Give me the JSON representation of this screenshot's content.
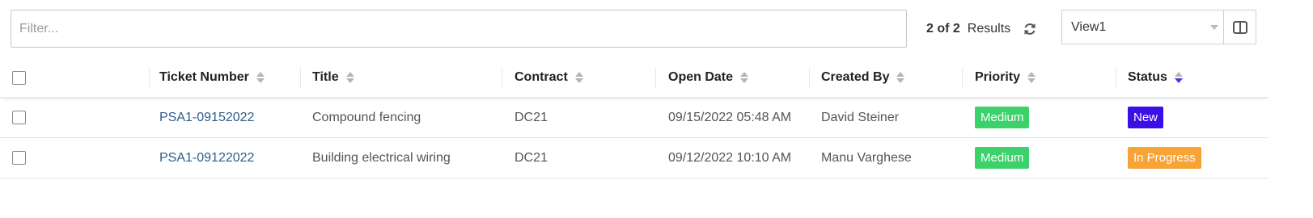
{
  "toolbar": {
    "filter_placeholder": "Filter...",
    "results_count": "2 of 2",
    "results_label": "Results",
    "view_value": "View1"
  },
  "table": {
    "headers": [
      "Ticket Number",
      "Title",
      "Contract",
      "Open Date",
      "Created By",
      "Priority",
      "Status"
    ],
    "sorted_column": "Status",
    "rows": [
      {
        "ticket": "PSA1-09152022",
        "title": "Compound fencing",
        "contract": "DC21",
        "open_date": "09/15/2022 05:48 AM",
        "created_by": "David Steiner",
        "priority": "Medium",
        "status": "New"
      },
      {
        "ticket": "PSA1-09122022",
        "title": "Building electrical wiring",
        "contract": "DC21",
        "open_date": "09/12/2022 10:10 AM",
        "created_by": "Manu Varghese",
        "priority": "Medium",
        "status": "In Progress"
      }
    ]
  },
  "colors": {
    "priority_medium": "#3dd16b",
    "status_new": "#3a0fe8",
    "status_in_progress": "#f7a335",
    "link": "#2e5c8a",
    "sort_active": "#3b3bd6"
  },
  "icons": {
    "refresh": "refresh-icon",
    "columns": "columns-icon",
    "sort": "sort-icon",
    "dropdown": "chevron-down-icon"
  }
}
